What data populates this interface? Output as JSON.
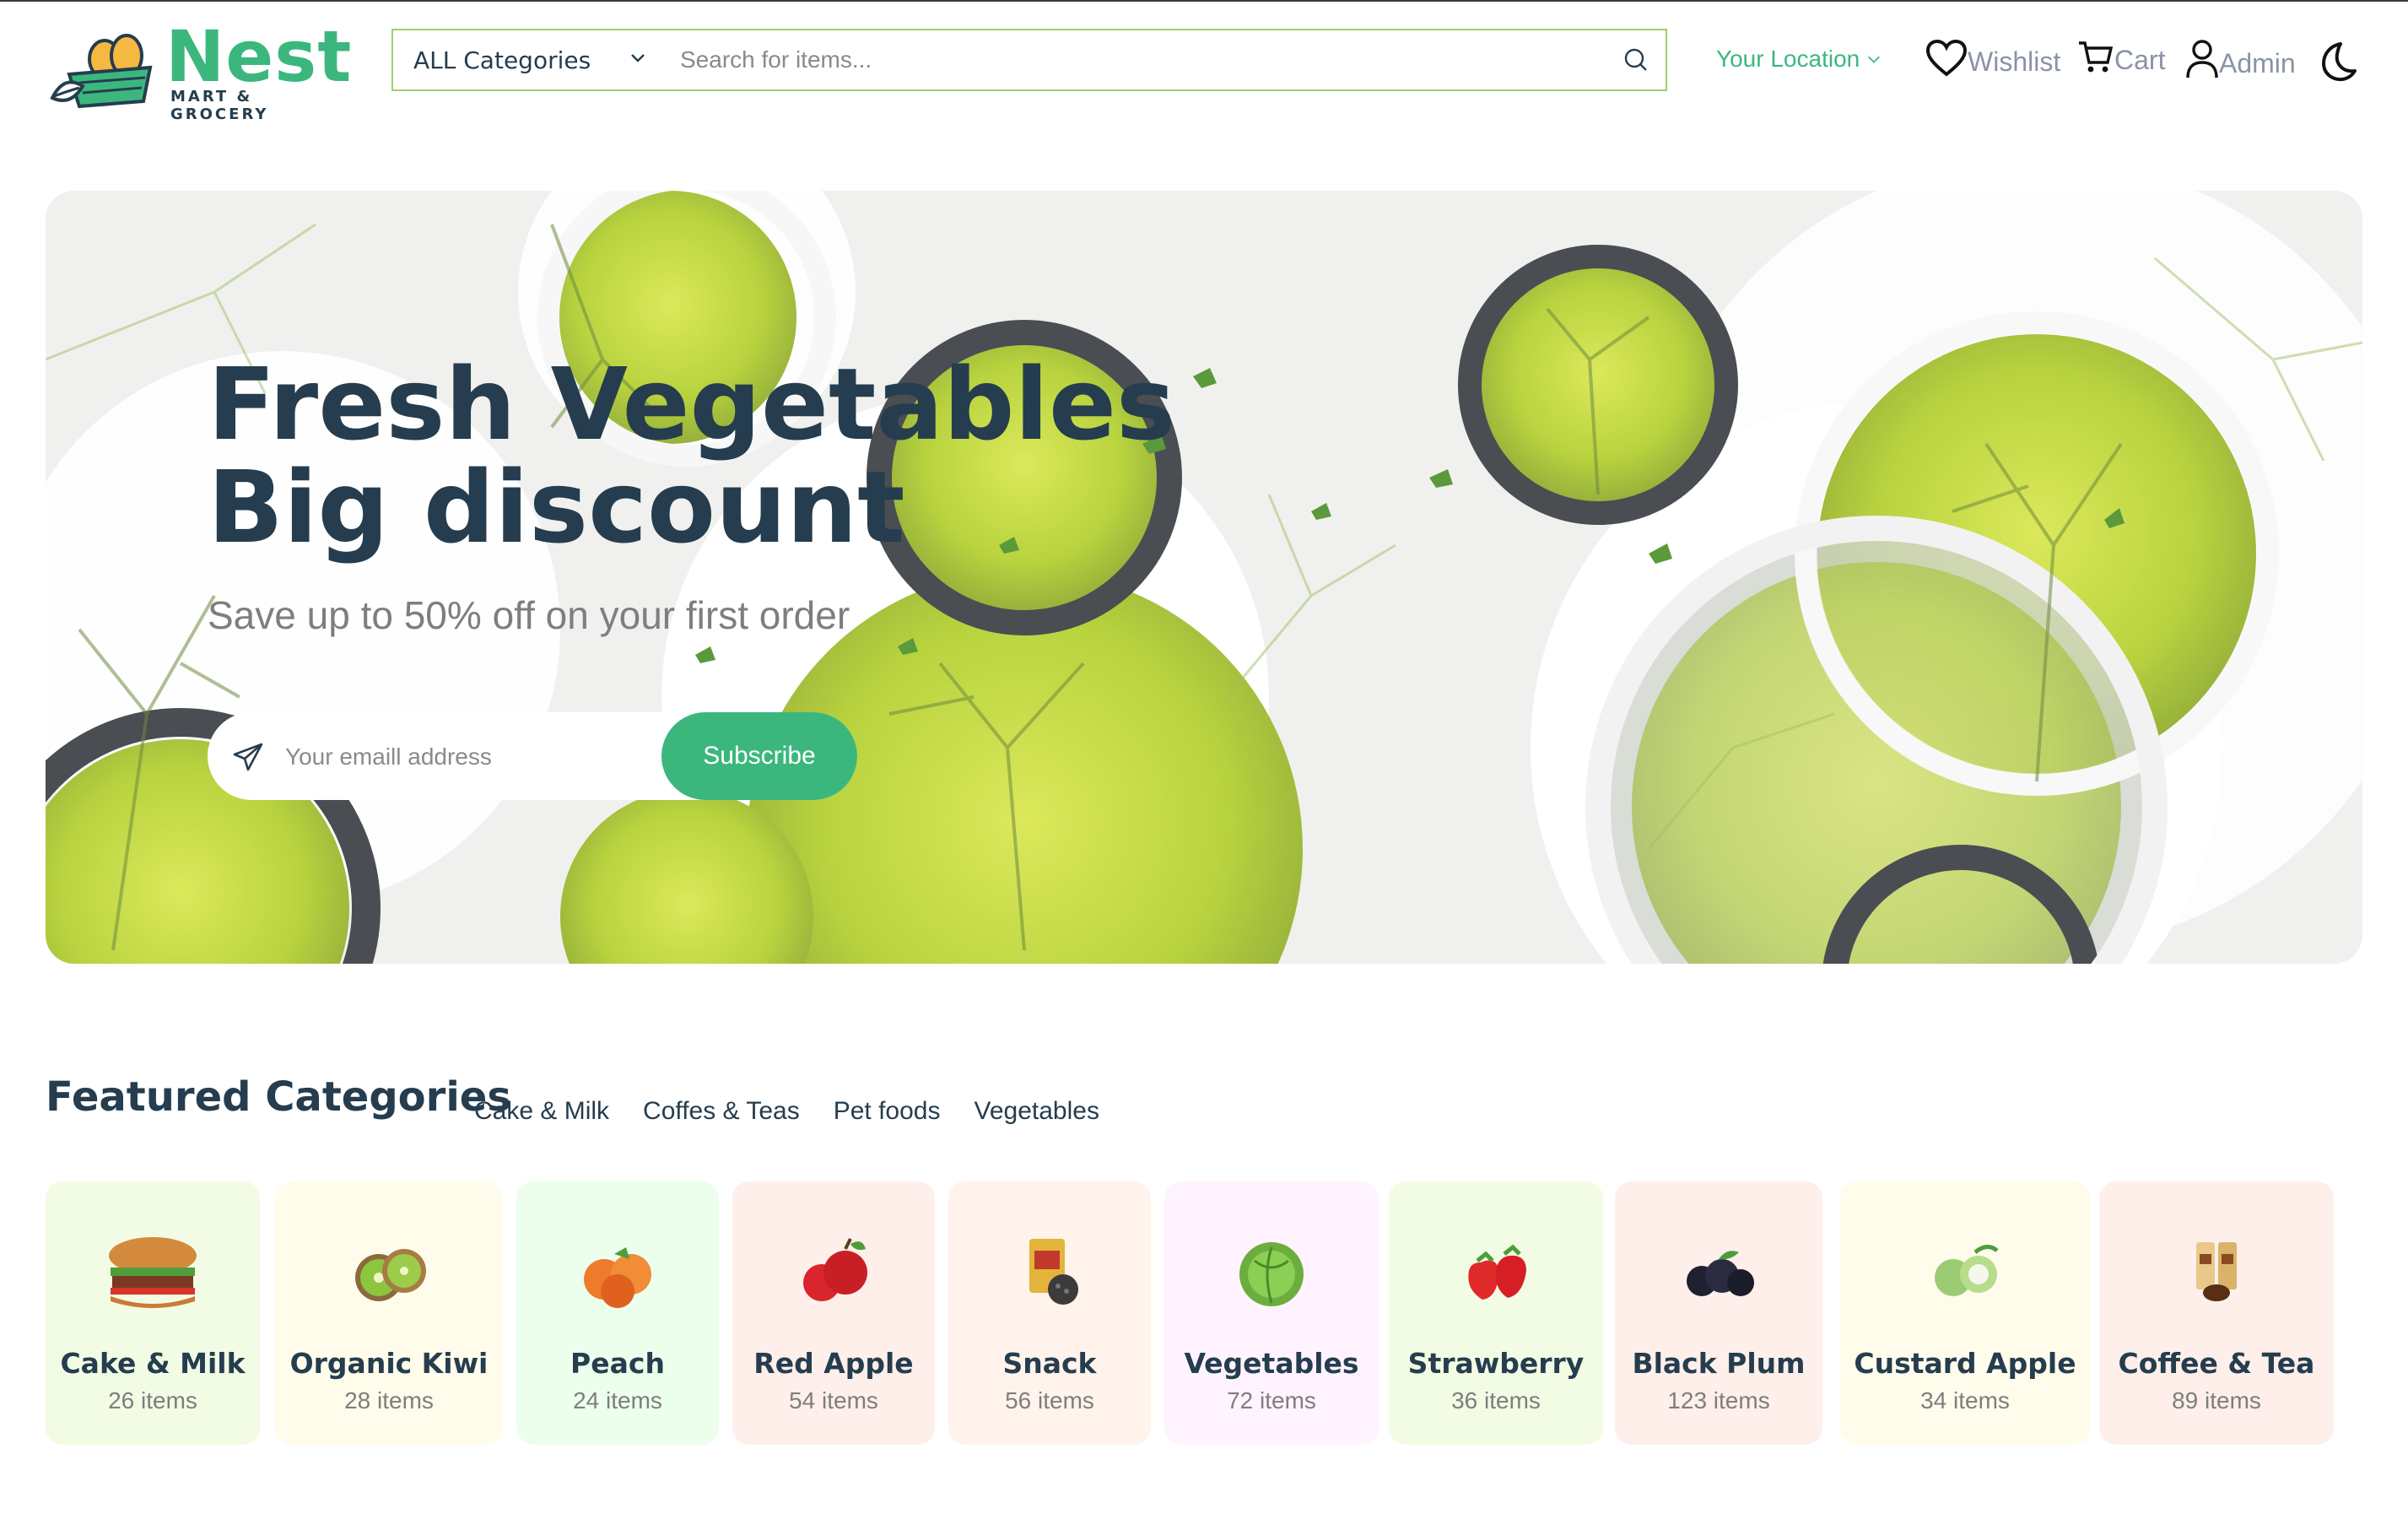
{
  "brand": {
    "name": "Nest",
    "tagline": "MART & GROCERY"
  },
  "header": {
    "category_select": "ALL Categories",
    "search_placeholder": "Search for items...",
    "location": "Your Location",
    "nav": {
      "wishlist": "Wishlist",
      "cart": "Cart",
      "admin": "Admin"
    }
  },
  "hero": {
    "title_line1": "Fresh Vegetables",
    "title_line2": "Big discount",
    "subtitle": "Save up to 50% off on your first order",
    "email_placeholder": "Your emaill address",
    "subscribe_label": "Subscribe"
  },
  "featured": {
    "title": "Featured Categories",
    "tabs": [
      "Cake & Milk",
      "Coffes & Teas",
      "Pet foods",
      "Vegetables"
    ],
    "categories": [
      {
        "name": "Cake & Milk",
        "count": "26 items",
        "bg": "#F2FCE4",
        "icon": "burger-icon"
      },
      {
        "name": "Organic Kiwi",
        "count": "28 items",
        "bg": "#FFFCEB",
        "icon": "kiwi-icon"
      },
      {
        "name": "Peach",
        "count": "24 items",
        "bg": "#ECFFEC",
        "icon": "peach-icon"
      },
      {
        "name": "Red Apple",
        "count": "54 items",
        "bg": "#FEEFEA",
        "icon": "apple-icon"
      },
      {
        "name": "Snack",
        "count": "56 items",
        "bg": "#FFF3EB",
        "icon": "snack-icon"
      },
      {
        "name": "Vegetables",
        "count": "72 items",
        "bg": "#FFF3FF",
        "icon": "cabbage-icon"
      },
      {
        "name": "Strawberry",
        "count": "36 items",
        "bg": "#F2FCE4",
        "icon": "strawberry-icon"
      },
      {
        "name": "Black Plum",
        "count": "123 items",
        "bg": "#FEEFEA",
        "icon": "plum-icon"
      },
      {
        "name": "Custard Apple",
        "count": "34 items",
        "bg": "#FFFCEB",
        "icon": "custard-apple-icon"
      },
      {
        "name": "Coffee & Tea",
        "count": "89 items",
        "bg": "#FEEFEA",
        "icon": "coffee-icon"
      }
    ]
  },
  "colors": {
    "brand": "#3BB77E",
    "heading": "#253D4E",
    "muted": "#7E7E7E"
  }
}
